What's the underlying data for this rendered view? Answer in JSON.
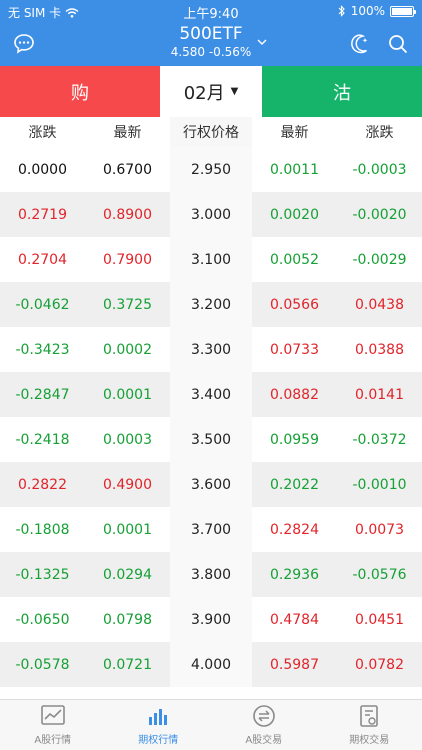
{
  "status": {
    "carrier": "无 SIM 卡",
    "time": "上午9:40",
    "battery": "100%"
  },
  "nav": {
    "title": "500ETF",
    "subtitle": "4.580 -0.56%"
  },
  "segment": {
    "buy": "购",
    "month": "02月",
    "sell": "沽"
  },
  "columns": {
    "call_change": "涨跌",
    "call_latest": "最新",
    "strike": "行权价格",
    "put_latest": "最新",
    "put_change": "涨跌"
  },
  "rows": [
    {
      "call_change": "0.0000",
      "call_latest": "0.6700",
      "strike": "2.950",
      "put_latest": "0.0011",
      "put_change": "-0.0003"
    },
    {
      "call_change": "0.2719",
      "call_latest": "0.8900",
      "strike": "3.000",
      "put_latest": "0.0020",
      "put_change": "-0.0020"
    },
    {
      "call_change": "0.2704",
      "call_latest": "0.7900",
      "strike": "3.100",
      "put_latest": "0.0052",
      "put_change": "-0.0029"
    },
    {
      "call_change": "-0.0462",
      "call_latest": "0.3725",
      "strike": "3.200",
      "put_latest": "0.0566",
      "put_change": "0.0438"
    },
    {
      "call_change": "-0.3423",
      "call_latest": "0.0002",
      "strike": "3.300",
      "put_latest": "0.0733",
      "put_change": "0.0388"
    },
    {
      "call_change": "-0.2847",
      "call_latest": "0.0001",
      "strike": "3.400",
      "put_latest": "0.0882",
      "put_change": "0.0141"
    },
    {
      "call_change": "-0.2418",
      "call_latest": "0.0003",
      "strike": "3.500",
      "put_latest": "0.0959",
      "put_change": "-0.0372"
    },
    {
      "call_change": "0.2822",
      "call_latest": "0.4900",
      "strike": "3.600",
      "put_latest": "0.2022",
      "put_change": "-0.0010"
    },
    {
      "call_change": "-0.1808",
      "call_latest": "0.0001",
      "strike": "3.700",
      "put_latest": "0.2824",
      "put_change": "0.0073"
    },
    {
      "call_change": "-0.1325",
      "call_latest": "0.0294",
      "strike": "3.800",
      "put_latest": "0.2936",
      "put_change": "-0.0576"
    },
    {
      "call_change": "-0.0650",
      "call_latest": "0.0798",
      "strike": "3.900",
      "put_latest": "0.4784",
      "put_change": "0.0451"
    },
    {
      "call_change": "-0.0578",
      "call_latest": "0.0721",
      "strike": "4.000",
      "put_latest": "0.5987",
      "put_change": "0.0782"
    }
  ],
  "tabs": [
    {
      "label": "A股行情",
      "icon": "chart-icon"
    },
    {
      "label": "期权行情",
      "icon": "bar-chart-icon"
    },
    {
      "label": "A股交易",
      "icon": "exchange-icon"
    },
    {
      "label": "期权交易",
      "icon": "document-icon"
    }
  ],
  "colors": {
    "primary": "#3d8fe6",
    "buy": "#f5494b",
    "sell": "#16b46b",
    "up": "#e1242a",
    "down": "#16a035"
  }
}
